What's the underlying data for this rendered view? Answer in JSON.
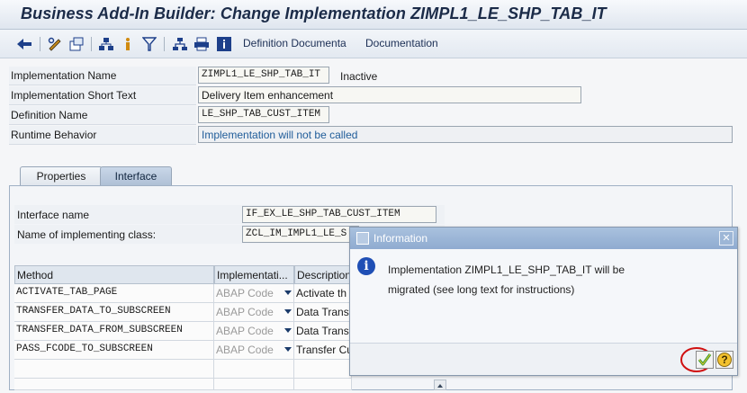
{
  "window": {
    "title": "Business Add-In Builder: Change Implementation ZIMPL1_LE_SHP_TAB_IT"
  },
  "toolbar": {
    "icons": [
      "back-arrow-icon",
      "edit-pencil-icon",
      "change-display-icon",
      "hierarchy-icon",
      "info-person-icon",
      "filter-icon",
      "tree-icon",
      "printer-icon",
      "information-icon"
    ],
    "link1": "Definition Documenta",
    "link2": "Documentation"
  },
  "form": {
    "impl_name_label": "Implementation Name",
    "impl_name_value": "ZIMPL1_LE_SHP_TAB_IT",
    "impl_status": "Inactive",
    "short_text_label": "Implementation Short Text",
    "short_text_value": "Delivery Item enhancement",
    "def_name_label": "Definition Name",
    "def_name_value": "LE_SHP_TAB_CUST_ITEM",
    "runtime_label": "Runtime Behavior",
    "runtime_value": "Implementation will not be called"
  },
  "tabs": [
    {
      "label": "Properties",
      "active": false
    },
    {
      "label": "Interface",
      "active": true
    }
  ],
  "interface": {
    "iface_label": "Interface name",
    "iface_value": "IF_EX_LE_SHP_TAB_CUST_ITEM",
    "class_label": "Name of implementing class:",
    "class_value": "ZCL_IM_IMPL1_LE_S"
  },
  "table": {
    "columns": [
      "Method",
      "Implementati...",
      "Description"
    ],
    "rows": [
      {
        "method": "ACTIVATE_TAB_PAGE",
        "impl": "ABAP Code",
        "desc": "Activate th"
      },
      {
        "method": "TRANSFER_DATA_TO_SUBSCREEN",
        "impl": "ABAP Code",
        "desc": "Data Transf"
      },
      {
        "method": "TRANSFER_DATA_FROM_SUBSCREEN",
        "impl": "ABAP Code",
        "desc": "Data Transf"
      },
      {
        "method": "PASS_FCODE_TO_SUBSCREEN",
        "impl": "ABAP Code",
        "desc": "Transfer Cu"
      }
    ]
  },
  "dialog": {
    "title": "Information",
    "message_line1": "Implementation ZIMPL1_LE_SHP_TAB_IT will be",
    "message_line2": "migrated (see long text for instructions)",
    "close_glyph": "✕",
    "info_glyph": "i",
    "help_glyph": "?"
  },
  "colors": {
    "title_text": "#1b2b48",
    "dialog_header": "#9cb6d8",
    "info_blue": "#1f4fb5",
    "confirm_green": "#2e9e2e",
    "highlight_red": "#d01010",
    "link_blue": "#1f5c99"
  }
}
